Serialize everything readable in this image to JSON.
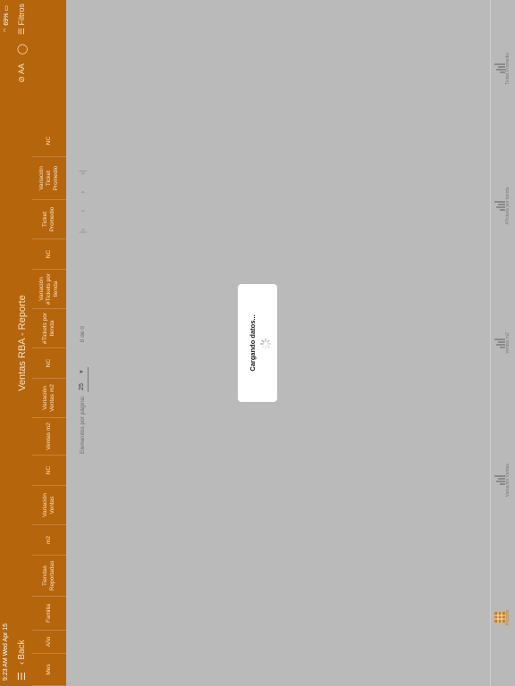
{
  "status": {
    "time_date": "9:23 AM  Wed Apr 15",
    "battery": "69%"
  },
  "nav": {
    "back_label": "Back",
    "title": "Ventas RBA - Reporte",
    "font_label": "AA",
    "filters_label": "Filtros"
  },
  "columns": [
    "Mes",
    "Año",
    "Familia",
    "Tiendas Reportadas",
    "m2",
    "Variación Ventas",
    "NC",
    "Ventas m2",
    "Variación Ventas m2",
    "NC",
    "#Tickets por tienda",
    "Variación #Tickets por tienda",
    "NC",
    "Ticket Promedio",
    "Variación Ticket Promedio",
    "NC"
  ],
  "pager": {
    "per_page_label": "Elementos por página:",
    "per_page_value": "25",
    "range": "0 de 0"
  },
  "loading": {
    "label": "Cargando datos..."
  },
  "tabs": [
    {
      "label": "Reporte",
      "icon": "grid-icon"
    },
    {
      "label": "Variación Ventas",
      "icon": "bar-chart-icon"
    },
    {
      "label": "Ventas m2",
      "icon": "bar-chart-icon"
    },
    {
      "label": "#Tickets por tienda",
      "icon": "bar-chart-icon"
    },
    {
      "label": "Ticket Promedio",
      "icon": "bar-chart-icon"
    }
  ],
  "colors": {
    "accent": "#b5650b",
    "background": "#bababa"
  }
}
